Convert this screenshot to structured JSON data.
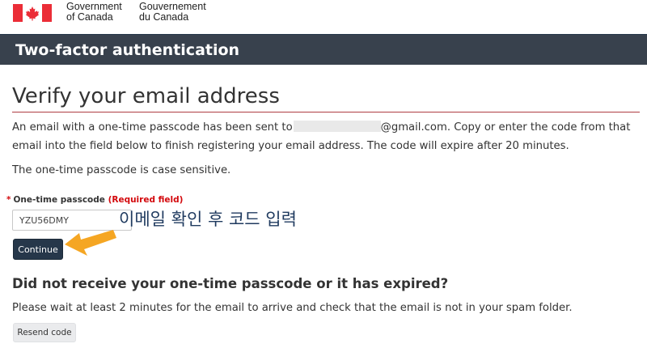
{
  "header": {
    "signature_en_line1": "Government",
    "signature_en_line2": "of Canada",
    "signature_fr_line1": "Gouvernement",
    "signature_fr_line2": "du Canada",
    "flag_icon": "canada-flag-icon",
    "flag_color": "#eb2d37"
  },
  "banner": {
    "title": "Two-factor authentication",
    "background": "#38414d"
  },
  "main": {
    "heading": "Verify your email address",
    "intro_part1": "An email with a one-time passcode has been sent to",
    "intro_part2": "@gmail.com. Copy or enter the code from that email into the field below to finish registering your email address. The code will expire after 20 minutes.",
    "case_note": "The one-time passcode is case sensitive.",
    "field_label": "One-time passcode",
    "required_star": "*",
    "required_text": "(Required field)",
    "passcode_value": "YZU56DMY",
    "continue_label": "Continue",
    "annotation": "이메일 확인 후 코드 입력",
    "annotation_arrow_color": "#f5a623",
    "expired_heading": "Did not receive your one-time passcode or it has expired?",
    "wait_note": "Please wait at least 2 minutes for the email to arrive and check that the email is not in your spam folder.",
    "resend_label": "Resend code",
    "continue_color": "#26374a",
    "required_color": "#d3080c"
  }
}
